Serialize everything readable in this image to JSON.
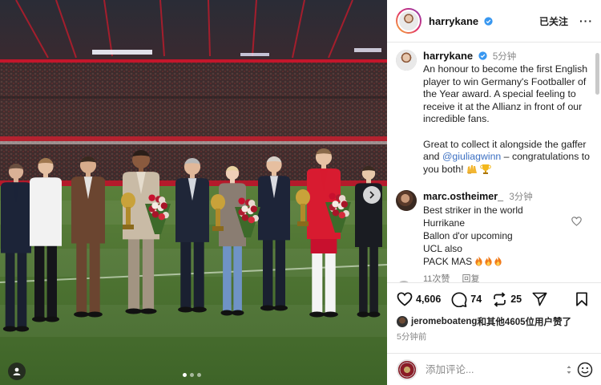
{
  "post": {
    "username": "harrykane",
    "follow_state": "已关注",
    "more_icon": "more-horizontal-icon"
  },
  "caption": {
    "username": "harrykane",
    "time": "5分钟",
    "text_part1": "An honour to become the first English player to win Germany's Footballer of the Year award. A special feeling to receive it at the Allianz in front of our incredible fans.\n\nGreat to collect it alongside the gaffer and ",
    "mention": "@giuliagwinn",
    "text_part2": " – congratulations to you both! ",
    "emojis": [
      "raised-hands-emoji",
      "trophy-emoji"
    ]
  },
  "comments": [
    {
      "username": "marc.ostheimer_",
      "time": "3分钟",
      "text": "Best striker in the world\nHurrikane\nBallon d'or upcoming\nUCL also\nPACK MAS ",
      "emojis": [
        "fire-emoji",
        "fire-emoji",
        "fire-emoji"
      ],
      "likes": "11次赞",
      "reply_label": "回复"
    }
  ],
  "actions": {
    "likes_count": "4,606",
    "comments_count": "74",
    "reposts_count": "25",
    "icons": [
      "heart-icon",
      "comment-icon",
      "repost-icon",
      "share-icon",
      "bookmark-icon"
    ]
  },
  "liked_by": {
    "user": "jeromeboateng",
    "rest": "和其他4605位用户赞了"
  },
  "post_time": "5分钟前",
  "comment_box": {
    "placeholder": "添加评论...",
    "emoji_icon": "smiley-icon"
  },
  "carousel": {
    "slide_count": 3,
    "active_slide": 1
  },
  "colors": {
    "verified": "#3897f0",
    "mention": "#3b6fc2",
    "pitch": "#4f7a33",
    "bayern_red": "#d8102b"
  }
}
